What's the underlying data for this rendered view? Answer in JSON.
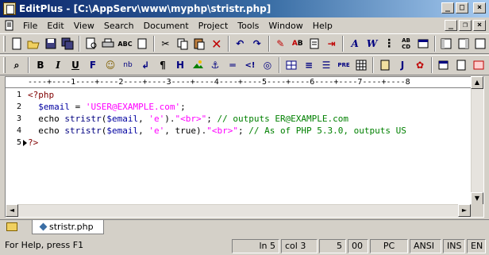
{
  "window": {
    "title": "EditPlus - [C:\\AppServ\\www\\myphp\\stristr.php]"
  },
  "menubar": {
    "items": [
      "File",
      "Edit",
      "View",
      "Search",
      "Document",
      "Project",
      "Tools",
      "Window",
      "Help"
    ]
  },
  "ruler": {
    "text": "----+----1----+----2----+----3----+----4----+----5----+----6----+----7----+----8"
  },
  "editor": {
    "line_numbers": [
      "1",
      "2",
      "3",
      "4",
      "5"
    ],
    "current_line": 5,
    "lines": [
      [
        {
          "t": "<?php",
          "c": "kw-php"
        }
      ],
      [
        {
          "t": "  ",
          "c": "plain"
        },
        {
          "t": "$email",
          "c": "var"
        },
        {
          "t": " = ",
          "c": "plain"
        },
        {
          "t": "'USER@EXAMPLE.com'",
          "c": "str"
        },
        {
          "t": ";",
          "c": "plain"
        }
      ],
      [
        {
          "t": "  echo ",
          "c": "plain"
        },
        {
          "t": "stristr",
          "c": "fn"
        },
        {
          "t": "(",
          "c": "plain"
        },
        {
          "t": "$email",
          "c": "var"
        },
        {
          "t": ", ",
          "c": "plain"
        },
        {
          "t": "'e'",
          "c": "str"
        },
        {
          "t": ").",
          "c": "plain"
        },
        {
          "t": "\"<br>\"",
          "c": "str"
        },
        {
          "t": "; ",
          "c": "plain"
        },
        {
          "t": "// outputs ER@EXAMPLE.com",
          "c": "cmt"
        }
      ],
      [
        {
          "t": "  echo ",
          "c": "plain"
        },
        {
          "t": "stristr",
          "c": "fn"
        },
        {
          "t": "(",
          "c": "plain"
        },
        {
          "t": "$email",
          "c": "var"
        },
        {
          "t": ", ",
          "c": "plain"
        },
        {
          "t": "'e'",
          "c": "str"
        },
        {
          "t": ", true).",
          "c": "plain"
        },
        {
          "t": "\"<br>\"",
          "c": "str"
        },
        {
          "t": "; ",
          "c": "plain"
        },
        {
          "t": "// As of PHP 5.3.0, outputs US",
          "c": "cmt"
        }
      ],
      [
        {
          "t": "?>",
          "c": "kw-php"
        }
      ]
    ]
  },
  "tabs": [
    {
      "label": "stristr.php",
      "active": true
    }
  ],
  "status": {
    "help": "For Help, press F1",
    "line": "ln 5",
    "col": "col 3",
    "value_a": "5",
    "value_b": "00",
    "mode": "PC",
    "encoding": "ANSI",
    "ins": "INS",
    "readonly": "EN"
  },
  "colors": {
    "titlebar_start": "#0a246a",
    "titlebar_end": "#a6caf0",
    "php_tag": "#800000",
    "variable": "#0000a0",
    "string": "#ff00ff",
    "comment": "#008000"
  },
  "icons": {
    "toolbar1": [
      "new-file-icon",
      "open-icon",
      "save-icon",
      "save-all-icon",
      "print-preview-icon",
      "print-icon",
      "spell-check-icon",
      "page-icon",
      "cut-icon",
      "copy-icon",
      "paste-icon",
      "delete-icon",
      "undo-icon",
      "redo-icon",
      "highlight-icon",
      "replace-icon",
      "copy-file-icon",
      "goto-icon",
      "font-icon",
      "word-wrap-icon",
      "column-icon",
      "abc-icon",
      "output-icon",
      "directory-icon",
      "cliptext-icon",
      "window-icon"
    ],
    "toolbar2": [
      "find-icon",
      "bold-icon",
      "italic-icon",
      "underline-icon",
      "font-face-icon",
      "color-icon",
      "nbsp-icon",
      "line-break-icon",
      "paragraph-icon",
      "heading-icon",
      "image-icon",
      "anchor-icon",
      "hr-icon",
      "comment-icon",
      "table-icon",
      "center-icon",
      "align-icon",
      "pre-icon",
      "grid-icon",
      "form-icon",
      "java-icon",
      "plugin-icon",
      "run-icon",
      "preview-icon",
      "browser-icon"
    ]
  }
}
